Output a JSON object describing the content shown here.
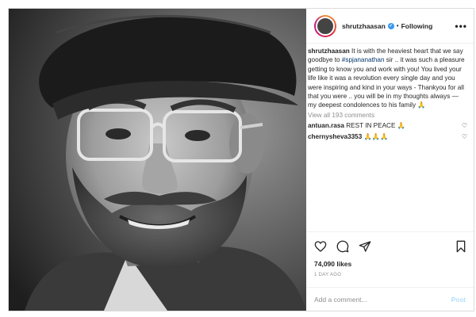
{
  "post": {
    "username": "shrutzhaasan",
    "follow_separator": "•",
    "follow_label": "Following",
    "more_label": "•••"
  },
  "caption": {
    "username": "shrutzhaasan",
    "text_a": " It is with the heaviest heart that we say goodbye to ",
    "tag": "#spjananathan",
    "text_b": " sir .. it was such a pleasure getting to know you and work with you! You lived your life like it was a revolution every single day and you were inspiring and kind in your ways - Thankyou for all that you were .. you will be in my thoughts always — my deepest condolences to his family 🙏"
  },
  "view_all": "View all 193 comments",
  "comments": [
    {
      "user": "antuan.rasa",
      "text": " REST IN PEACE 🙏"
    },
    {
      "user": "chernysheva3353",
      "text": " 🙏🙏🙏"
    }
  ],
  "likes": "74,090 likes",
  "time_ago": "1 DAY AGO",
  "add_comment": {
    "placeholder": "Add a comment...",
    "post_label": "Post"
  },
  "icons": {
    "like": "heart-icon",
    "comment": "comment-icon",
    "share": "share-icon",
    "save": "bookmark-icon",
    "verified": "verified-badge-icon"
  }
}
